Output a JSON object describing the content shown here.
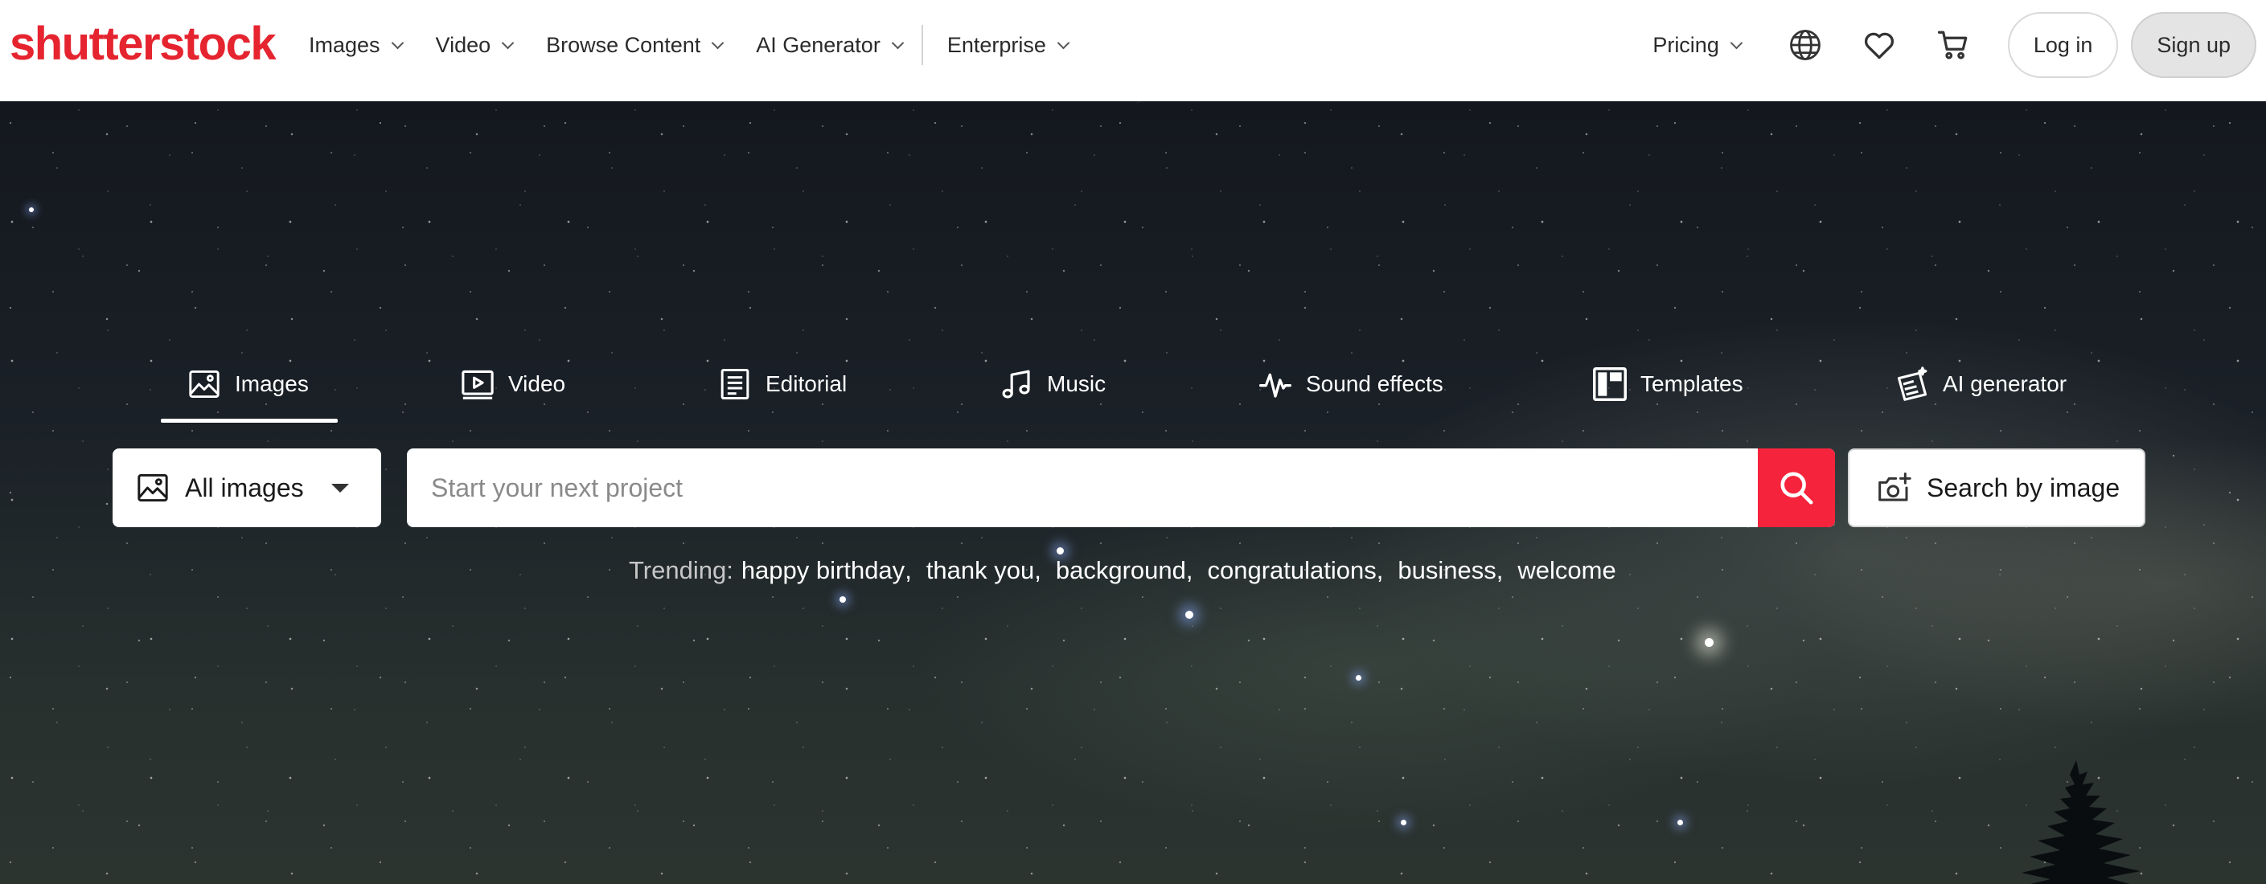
{
  "header": {
    "logo_text": "shutterstock",
    "nav": [
      {
        "label": "Images"
      },
      {
        "label": "Video"
      },
      {
        "label": "Browse Content"
      },
      {
        "label": "AI Generator"
      },
      {
        "label": "Enterprise"
      }
    ],
    "pricing_label": "Pricing",
    "login_label": "Log in",
    "signup_label": "Sign up",
    "icons": [
      "globe-icon",
      "heart-icon",
      "cart-icon"
    ]
  },
  "tabs": [
    {
      "label": "Images",
      "icon": "image-icon",
      "active": true
    },
    {
      "label": "Video",
      "icon": "play-icon"
    },
    {
      "label": "Editorial",
      "icon": "document-icon"
    },
    {
      "label": "Music",
      "icon": "music-note-icon"
    },
    {
      "label": "Sound effects",
      "icon": "waveform-icon"
    },
    {
      "label": "Templates",
      "icon": "template-icon"
    },
    {
      "label": "AI generator",
      "icon": "ai-generator-icon"
    }
  ],
  "search": {
    "type_label": "All images",
    "placeholder": "Start your next project",
    "value": "",
    "search_by_image_label": "Search by image"
  },
  "trending": {
    "label": "Trending:",
    "terms": [
      "happy birthday",
      "thank you",
      "background",
      "congratulations",
      "business",
      "welcome"
    ]
  },
  "colors": {
    "brand": "#e5242f",
    "search_button": "#f5243c"
  }
}
